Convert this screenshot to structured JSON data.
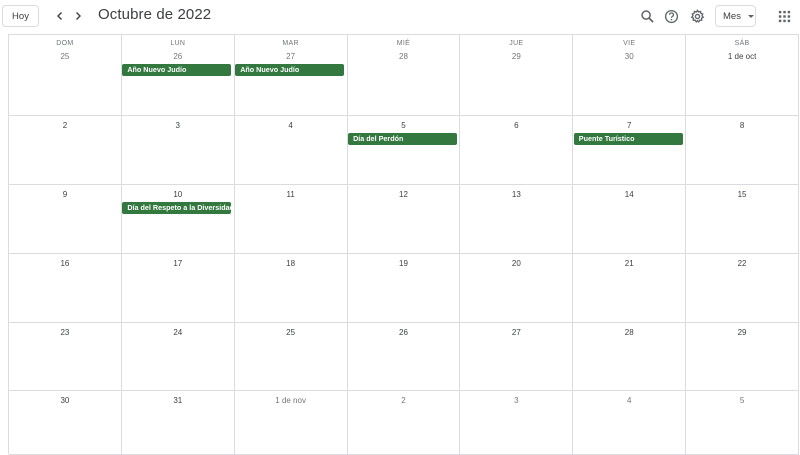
{
  "header": {
    "today_label": "Hoy",
    "title": "Octubre de 2022",
    "view_label": "Mes"
  },
  "weekdays": [
    "DOM",
    "LUN",
    "MAR",
    "MIÉ",
    "JUE",
    "VIE",
    "SÁB"
  ],
  "weeks": [
    [
      "25",
      "26",
      "27",
      "28",
      "29",
      "30",
      "1 de oct"
    ],
    [
      "2",
      "3",
      "4",
      "5",
      "6",
      "7",
      "8"
    ],
    [
      "9",
      "10",
      "11",
      "12",
      "13",
      "14",
      "15"
    ],
    [
      "16",
      "17",
      "18",
      "19",
      "20",
      "21",
      "22"
    ],
    [
      "23",
      "24",
      "25",
      "26",
      "27",
      "28",
      "29"
    ],
    [
      "30",
      "31",
      "1 de nov",
      "2",
      "3",
      "4",
      "5"
    ]
  ],
  "events": [
    {
      "week": 0,
      "day": 1,
      "title": "Año Nuevo Judío"
    },
    {
      "week": 0,
      "day": 2,
      "title": "Año Nuevo Judío"
    },
    {
      "week": 1,
      "day": 3,
      "title": "Día del Perdón"
    },
    {
      "week": 1,
      "day": 5,
      "title": "Puente Turístico"
    },
    {
      "week": 2,
      "day": 1,
      "title": "Día del Respeto a la Diversidad Cultural"
    }
  ],
  "colors": {
    "event": "#33783e",
    "grid": "#dadce0"
  }
}
